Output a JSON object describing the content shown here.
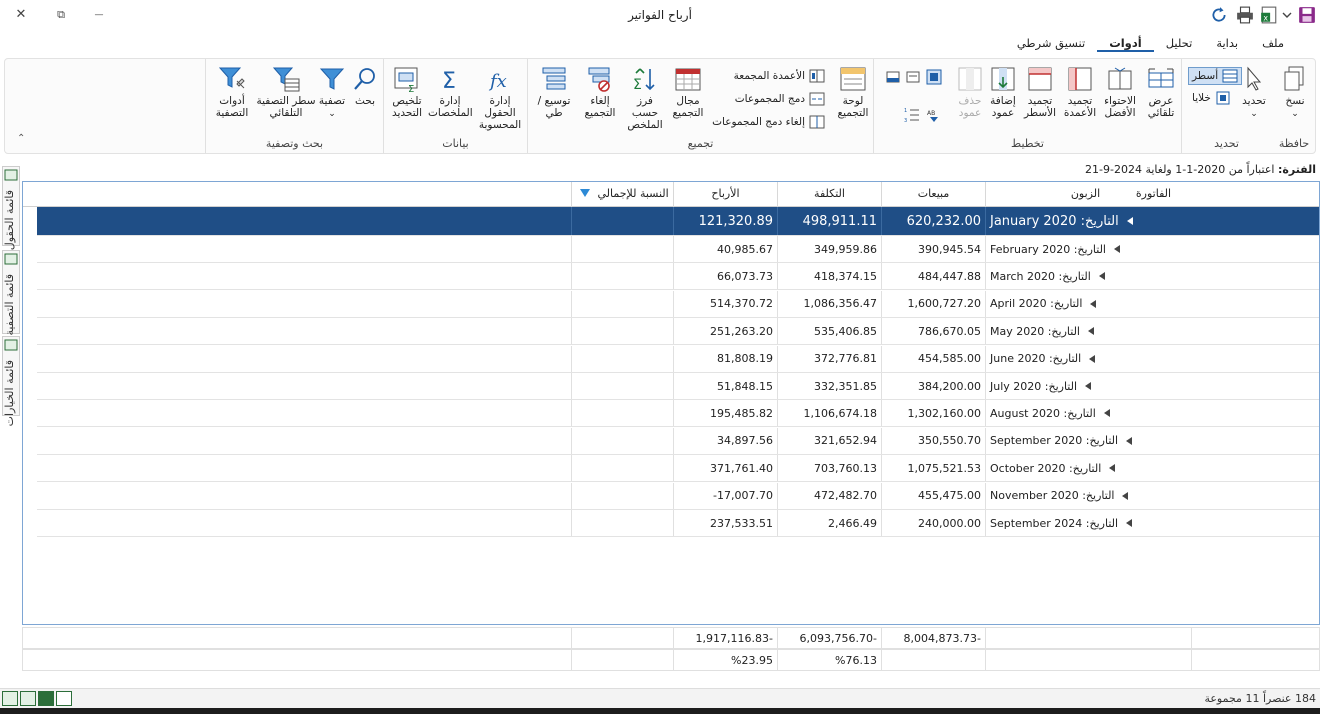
{
  "window": {
    "title": "أرباح الفواتير",
    "close": "✕",
    "restore": "⧉",
    "minimize": "—"
  },
  "quick_access": [
    "save-icon",
    "dropdown-icon",
    "excel-export-icon",
    "print-icon",
    "refresh-icon"
  ],
  "tabs": [
    "ملف",
    "بداية",
    "تحليل",
    "أدوات",
    "تنسيق شرطي"
  ],
  "active_tab": "أدوات",
  "ribbon": {
    "clipboard": {
      "label": "حافظة",
      "copy": "نسخ"
    },
    "select": {
      "label": "تحديد",
      "select": "تحديد",
      "rows": "أسطر",
      "cells": "خلايا"
    },
    "layout": {
      "label": "تخطيط",
      "autoshow": "عرض تلقائي",
      "bestfit": "الاحتواء الأفضل",
      "freeze_cols": "تجميد الأعمدة",
      "freeze_rows": "تجميد الأسطر",
      "add_col": "إضافة عمود",
      "del_col": "حذف عمود"
    },
    "grouping": {
      "label": "تجميع",
      "group_panel": "لوحة التجميع",
      "grouped_cols": "الأعمدة المجمعة",
      "merge_groups": "دمج المجموعات",
      "unmerge_groups": "إلغاء دمج المجموعات",
      "group_range": "مجال التجميع",
      "sort_summary": "فرز حسب الملخص",
      "ungroup": "إلغاء التجميع",
      "expand": "توسيع / طي"
    },
    "data": {
      "label": "بيانات",
      "calc_fields": "إدارة الحقول المحسوبة",
      "summaries": "إدارة الملخصات",
      "sel_summary": "تلخيص التحديد"
    },
    "search": {
      "label": "بحث وتصفية",
      "search": "بحث",
      "filter": "تصفية",
      "autofilter": "سطر التصفية التلقائي",
      "filter_tools": "أدوات التصفية"
    }
  },
  "side_panels": [
    "قائمة الحقول",
    "قائمة التصفية",
    "قائمة الخيارات"
  ],
  "period": {
    "label": "الفترة:",
    "text": "اعتباراً من 2020-1-1 ولغاية 2024-9-21"
  },
  "columns": [
    "الفاتورة",
    "الزبون",
    "مبيعات",
    "التكلفة",
    "الأرباح",
    "النسبة للإجمالي"
  ],
  "rows": [
    {
      "group": "التاريخ: January 2020",
      "sales": "620,232.00",
      "cost": "498,911.11",
      "profit": "121,320.89"
    },
    {
      "group": "التاريخ: February 2020",
      "sales": "390,945.54",
      "cost": "349,959.86",
      "profit": "40,985.67"
    },
    {
      "group": "التاريخ: March 2020",
      "sales": "484,447.88",
      "cost": "418,374.15",
      "profit": "66,073.73"
    },
    {
      "group": "التاريخ: April 2020",
      "sales": "1,600,727.20",
      "cost": "1,086,356.47",
      "profit": "514,370.72"
    },
    {
      "group": "التاريخ: May 2020",
      "sales": "786,670.05",
      "cost": "535,406.85",
      "profit": "251,263.20"
    },
    {
      "group": "التاريخ: June 2020",
      "sales": "454,585.00",
      "cost": "372,776.81",
      "profit": "81,808.19"
    },
    {
      "group": "التاريخ: July 2020",
      "sales": "384,200.00",
      "cost": "332,351.85",
      "profit": "51,848.15"
    },
    {
      "group": "التاريخ: August 2020",
      "sales": "1,302,160.00",
      "cost": "1,106,674.18",
      "profit": "195,485.82"
    },
    {
      "group": "التاريخ: September 2020",
      "sales": "350,550.70",
      "cost": "321,652.94",
      "profit": "34,897.56"
    },
    {
      "group": "التاريخ: October 2020",
      "sales": "1,075,521.53",
      "cost": "703,760.13",
      "profit": "371,761.40"
    },
    {
      "group": "التاريخ: November 2020",
      "sales": "455,475.00",
      "cost": "472,482.70",
      "profit": "-17,007.70"
    },
    {
      "group": "التاريخ: September 2024",
      "sales": "240,000.00",
      "cost": "2,466.49",
      "profit": "237,533.51"
    }
  ],
  "totals": {
    "sales": "8,004,873.73-",
    "cost": "6,093,756.70-",
    "profit": "1,917,116.83-"
  },
  "percents": {
    "cost": "%76.13",
    "profit": "%23.95"
  },
  "status": {
    "count": "184 عنصراً 11 مجموعة"
  },
  "colors": {
    "accent": "#1f4e86",
    "border": "#7ea6d4"
  }
}
